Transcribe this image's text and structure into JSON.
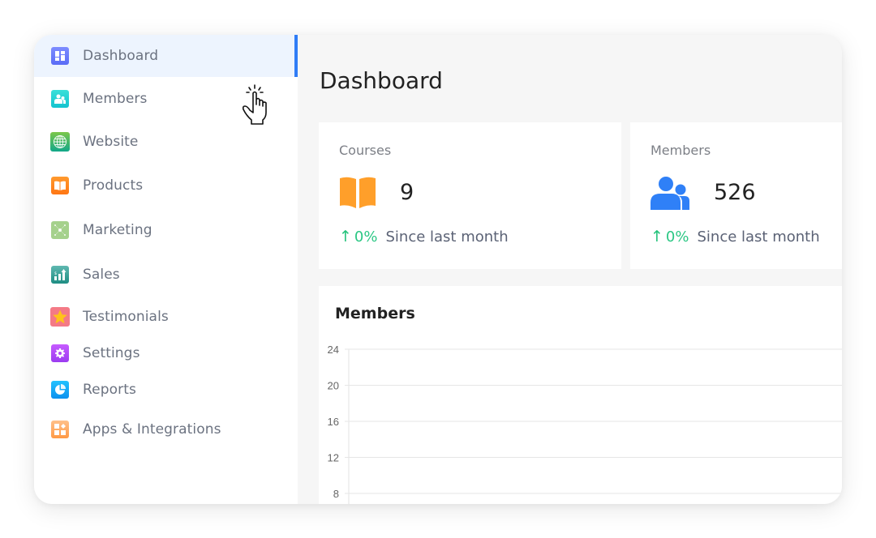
{
  "sidebar": {
    "items": [
      {
        "label": "Dashboard",
        "icon": "dashboard-icon",
        "color": "#6b7bff",
        "active": true
      },
      {
        "label": "Members",
        "icon": "members-icon",
        "color": "#22d3ce"
      },
      {
        "label": "Website",
        "icon": "globe-icon",
        "color": "#3db86a"
      },
      {
        "label": "Products",
        "icon": "book-icon",
        "color": "#ff8a1f"
      },
      {
        "label": "Marketing",
        "icon": "marketing-icon",
        "color": "#a5d18c"
      },
      {
        "label": "Sales",
        "icon": "sales-chart-icon",
        "color": "#2a9d8f"
      },
      {
        "label": "Testimonials",
        "icon": "star-icon",
        "color": "#f47a86"
      },
      {
        "label": "Settings",
        "icon": "gear-icon",
        "color": "#b04cf6"
      },
      {
        "label": "Reports",
        "icon": "pie-chart-icon",
        "color": "#18aaf5"
      },
      {
        "label": "Apps & Integrations",
        "icon": "apps-icon",
        "color": "#ffa35c"
      }
    ],
    "accent": "#2f7cf6"
  },
  "main": {
    "title": "Dashboard",
    "cards": [
      {
        "title": "Courses",
        "value": "9",
        "icon": "open-book-icon",
        "trend_pct": "0%",
        "trend_text": "Since last month",
        "icon_color": "#ff9f2a"
      },
      {
        "title": "Members",
        "value": "526",
        "icon": "users-icon",
        "trend_pct": "0%",
        "trend_text": "Since last month",
        "icon_color": "#2f80f7"
      }
    ],
    "trend_color": "#22c27a"
  },
  "chart_data": {
    "type": "line",
    "title": "Members",
    "xlabel": "",
    "ylabel": "",
    "yticks": [
      24,
      20,
      16,
      12,
      8
    ],
    "ylim": [
      8,
      24
    ],
    "grid": true,
    "series": []
  }
}
